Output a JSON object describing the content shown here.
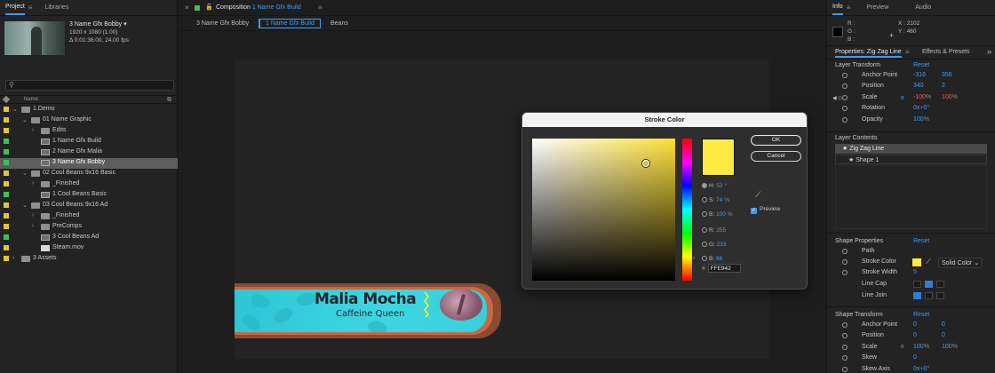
{
  "project_panel": {
    "tabs": [
      "Project",
      "Libraries"
    ],
    "active_tab": "Project",
    "selected_item": {
      "name": "3 Name Gfx Bobby ▾",
      "resolution": "1920 x 1080 (1.00)",
      "duration": "Δ 0:01:36:00, 24.00 fps"
    },
    "search_placeholder": "",
    "column_name": "Name",
    "items": [
      {
        "label": "1.Demo",
        "depth": 0,
        "type": "folder",
        "open": true,
        "color": "#e0c53a"
      },
      {
        "label": "01 Name Graphic",
        "depth": 1,
        "type": "folder",
        "open": true,
        "color": "#e0c53a"
      },
      {
        "label": "Edits",
        "depth": 2,
        "type": "folder",
        "open": false,
        "color": "#e0c53a"
      },
      {
        "label": "1 Name Gfx Build",
        "depth": 2,
        "type": "comp",
        "color": "#3fbf5a"
      },
      {
        "label": "2 Name Gfx Malia",
        "depth": 2,
        "type": "comp",
        "color": "#3fbf5a"
      },
      {
        "label": "3 Name Gfx Bobby",
        "depth": 2,
        "type": "comp",
        "color": "#3fbf5a",
        "selected": true
      },
      {
        "label": "02 Cool Beans 9x16 Basic",
        "depth": 1,
        "type": "folder",
        "open": true,
        "color": "#e0c53a"
      },
      {
        "label": "_Finished",
        "depth": 2,
        "type": "folder",
        "open": false,
        "color": "#e0c53a"
      },
      {
        "label": "1 Cool Beans Basic",
        "depth": 2,
        "type": "comp",
        "color": "#3fbf5a"
      },
      {
        "label": "03 Cool Beans 9x16 Ad",
        "depth": 1,
        "type": "folder",
        "open": true,
        "color": "#e0c53a"
      },
      {
        "label": "_Finished",
        "depth": 2,
        "type": "folder",
        "open": false,
        "color": "#e0c53a"
      },
      {
        "label": "PreComps",
        "depth": 2,
        "type": "folder",
        "open": false,
        "color": "#e0c53a"
      },
      {
        "label": "3 Cool Beans Ad",
        "depth": 2,
        "type": "comp",
        "color": "#3fbf5a"
      },
      {
        "label": "Steam.mov",
        "depth": 2,
        "type": "file",
        "color": "#e0c53a"
      },
      {
        "label": "3 Assets",
        "depth": 0,
        "type": "folder",
        "open": false,
        "color": "#e0c53a"
      }
    ]
  },
  "composition": {
    "tab_prefix": "Composition",
    "tab_name": "1 Name Gfx Build",
    "breadcrumbs": [
      "3 Name Gfx Bobby",
      "1 Name Gfx Build",
      "Beans"
    ],
    "active_crumb": "1 Name Gfx Build",
    "lower_third": {
      "title": "Malia Mocha",
      "subtitle": "Caffeine Queen"
    }
  },
  "stroke_dialog": {
    "title": "Stroke Color",
    "ok": "OK",
    "cancel": "Cancel",
    "fields": [
      {
        "label": "H:",
        "value": "53",
        "unit": "°",
        "active": true
      },
      {
        "label": "S:",
        "value": "74",
        "unit": "%"
      },
      {
        "label": "B:",
        "value": "100",
        "unit": "%"
      },
      {
        "label": "R:",
        "value": "255",
        "unit": ""
      },
      {
        "label": "G:",
        "value": "233",
        "unit": ""
      },
      {
        "label": "B:",
        "value": "66",
        "unit": ""
      }
    ],
    "hex_prefix": "#",
    "hex": "FFE942",
    "preview_label": "Preview",
    "preview_checked": true,
    "new_color": "#ffe942"
  },
  "info_panel": {
    "tabs": [
      "Info",
      "Preview",
      "Audio"
    ],
    "rgb_labels": [
      "R :",
      "G :",
      "B :"
    ],
    "x_label": "X :",
    "x_value": "2102",
    "y_label": "Y :",
    "y_value": "460"
  },
  "properties_panel": {
    "tabs": [
      "Properties: Zig Zag Line",
      "Effects & Presets"
    ],
    "layer_transform": {
      "heading": "Layer Transform",
      "reset": "Reset",
      "rows": [
        {
          "name": "Anchor Point",
          "v1": "-316",
          "v2": "356"
        },
        {
          "name": "Position",
          "v1": "340",
          "v2": "2"
        },
        {
          "name": "Scale",
          "v1": "-100",
          "v1_unit": "%",
          "v2": "100",
          "v2_unit": "%",
          "red": true
        },
        {
          "name": "Rotation",
          "v1": "0x+0",
          "v1_unit": "°"
        },
        {
          "name": "Opacity",
          "v1": "100",
          "v1_unit": "%"
        }
      ]
    },
    "layer_contents": {
      "heading": "Layer Contents",
      "items": [
        "Zig Zag Line",
        "Shape 1"
      ]
    },
    "shape_properties": {
      "heading": "Shape Properties",
      "reset": "Reset",
      "path": "Path",
      "stroke_color_label": "Stroke Color",
      "stroke_type": "Solid Color",
      "stroke_width_label": "Stroke Width",
      "stroke_width": "5",
      "line_cap": "Line Cap",
      "line_join": "Line Join"
    },
    "shape_transform": {
      "heading": "Shape Transform",
      "reset": "Reset",
      "rows": [
        {
          "name": "Anchor Point",
          "v1": "0",
          "v2": "0"
        },
        {
          "name": "Position",
          "v1": "0",
          "v2": "0"
        },
        {
          "name": "Scale",
          "v1": "100",
          "v1_unit": "%",
          "v2": "100",
          "v2_unit": "%"
        },
        {
          "name": "Skew",
          "v1": "0"
        },
        {
          "name": "Skew Axis",
          "v1": "0x+0",
          "v1_unit": "°"
        }
      ]
    }
  },
  "colors": {
    "accent": "#3b9cff",
    "label_yellow": "#e0c53a",
    "label_green": "#3fbf5a",
    "stroke": "#ffe942"
  }
}
